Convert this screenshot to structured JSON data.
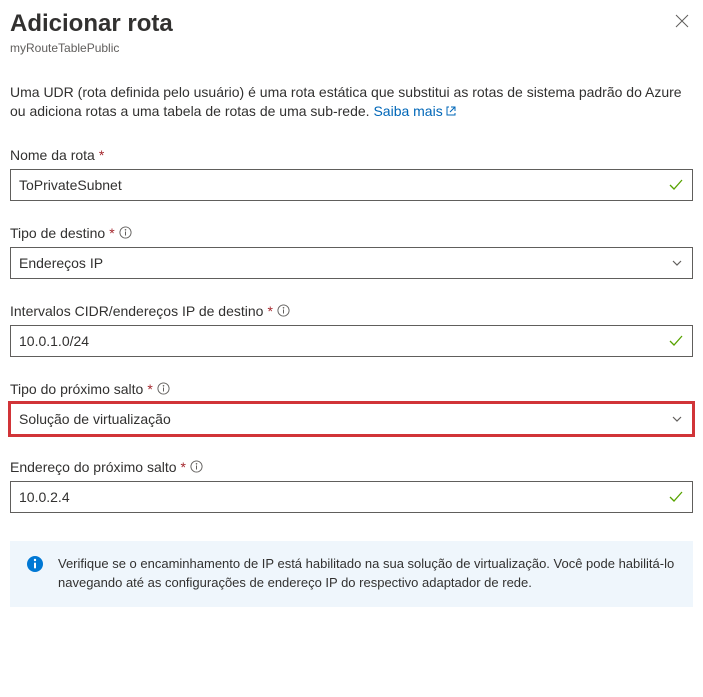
{
  "header": {
    "title": "Adicionar rota",
    "subtitle": "myRouteTablePublic"
  },
  "description": {
    "text": "Uma UDR (rota definida pelo usuário) é uma rota estática que substitui as rotas de sistema padrão do Azure ou adiciona rotas a uma tabela de rotas de uma sub-rede. ",
    "linkText": "Saiba mais"
  },
  "fields": {
    "routeName": {
      "label": "Nome da rota",
      "value": "ToPrivateSubnet"
    },
    "destType": {
      "label": "Tipo de destino",
      "value": "Endereços IP"
    },
    "cidr": {
      "label": "Intervalos CIDR/endereços IP de destino",
      "value": "10.0.1.0/24"
    },
    "nextHopType": {
      "label": "Tipo do próximo salto",
      "value": "Solução de virtualização"
    },
    "nextHopAddr": {
      "label": "Endereço do próximo salto",
      "value": "10.0.2.4"
    }
  },
  "infoBox": {
    "text": "Verifique se o encaminhamento de IP está habilitado na sua solução de virtualização. Você pode habilitá-lo navegando até as configurações de endereço IP do respectivo adaptador de rede."
  }
}
